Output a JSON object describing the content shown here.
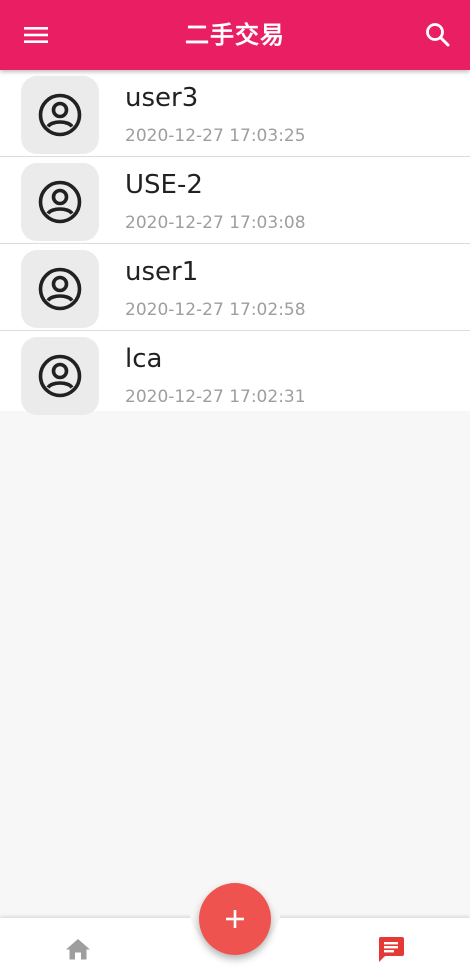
{
  "app_bar": {
    "title": "二手交易",
    "background": "#e91e63",
    "menu_icon": "menu-icon",
    "search_icon": "search-icon"
  },
  "conversations": [
    {
      "name": "user3",
      "time": "2020-12-27 17:03:25",
      "avatar_icon": "account-circle-icon"
    },
    {
      "name": "USE-2",
      "time": "2020-12-27 17:03:08",
      "avatar_icon": "account-circle-icon"
    },
    {
      "name": "user1",
      "time": "2020-12-27 17:02:58",
      "avatar_icon": "account-circle-icon"
    },
    {
      "name": "lca",
      "time": "2020-12-27 17:02:31",
      "avatar_icon": "account-circle-icon"
    }
  ],
  "bottom_nav": {
    "home_icon": "home-icon",
    "home_color": "#9e9e9e",
    "messages_icon": "message-icon",
    "messages_color": "#e53935",
    "fab_icon": "plus-icon",
    "fab_color": "#ef5350"
  }
}
